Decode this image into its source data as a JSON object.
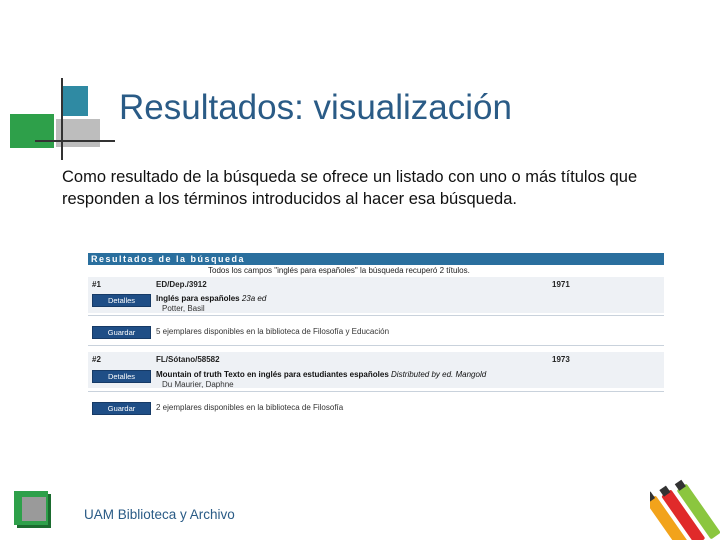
{
  "slide": {
    "title": "Resultados: visualización",
    "body": "Como resultado de la búsqueda se ofrece un listado con uno o más títulos que responden a los términos introducidos al hacer esa búsqueda.",
    "footer": "UAM Biblioteca y Archivo"
  },
  "screenshot": {
    "header": "Resultados de la búsqueda",
    "subheader": "Todos los campos \"inglés para españoles\" la búsqueda recuperó 2 títulos.",
    "records": [
      {
        "num": "#1",
        "location": "ED/Dep./3912",
        "year": "1971",
        "details_label": "Detalles",
        "title": "Inglés para españoles",
        "edition": "23a ed",
        "author": "Potter, Basil",
        "save_label": "Guardar",
        "copies": "5 ejemplares disponibles en la biblioteca de Filosofía y Educación"
      },
      {
        "num": "#2",
        "location": "FL/Sótano/58582",
        "year": "1973",
        "details_label": "Detalles",
        "title": "Mountain of truth Texto en inglés para estudiantes españoles",
        "edition": "Distributed by ed. Mangold",
        "author": "Du Maurier, Daphne",
        "save_label": "Guardar",
        "copies": "2 ejemplares disponibles en la biblioteca de Filosofía"
      }
    ]
  },
  "colors": {
    "title": "#2a5b86",
    "header_bar": "#2a6f9e",
    "button": "#1f4e86",
    "accent_green": "#2ea04a",
    "accent_teal": "#2f8aa3"
  }
}
